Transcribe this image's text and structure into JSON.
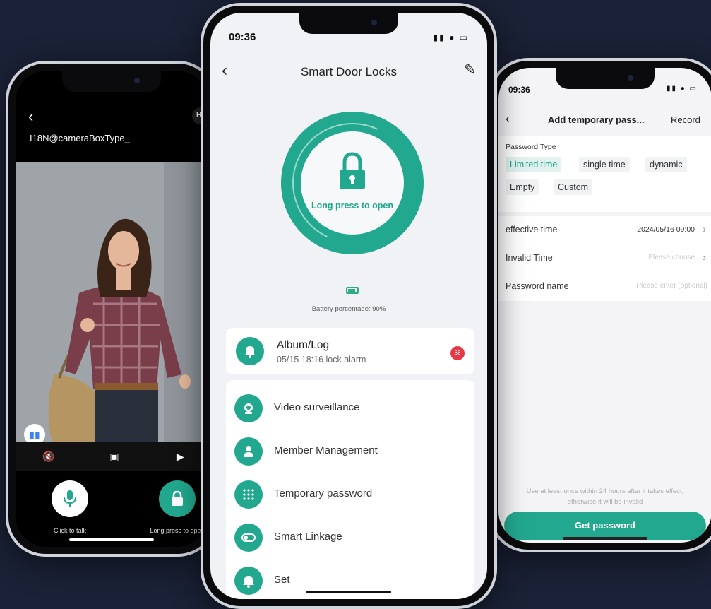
{
  "left_phone": {
    "camera_title": "I18N@cameraBoxType_",
    "hd_badge": "H",
    "talk_caption": "Click to talk",
    "open_caption": "Long press to open"
  },
  "center_phone": {
    "time": "09:36",
    "header_title": "Smart Door Locks",
    "lock_text": "Long press to open",
    "battery_text": "Battery percentage: 90%",
    "album": {
      "title": "Album/Log",
      "subtitle": "05/15 18:16 lock alarm",
      "badge": "66"
    },
    "menu": [
      {
        "label": "Video surveillance",
        "icon": "camera-icon"
      },
      {
        "label": "Member Management",
        "icon": "person-icon"
      },
      {
        "label": "Temporary password",
        "icon": "keypad-icon"
      },
      {
        "label": "Smart Linkage",
        "icon": "toggle-icon"
      },
      {
        "label": "Set",
        "icon": "bell-icon"
      }
    ]
  },
  "right_phone": {
    "time": "09:36",
    "header_title": "Add temporary pass...",
    "record_label": "Record",
    "password_type_label": "Password Type",
    "types": [
      "Limited time",
      "single time",
      "dynamic",
      "Empty",
      "Custom"
    ],
    "selected_type": "Limited time",
    "effective_time_label": "effective time",
    "effective_time_value": "2024/05/16 09:00",
    "invalid_time_label": "Invalid Time",
    "invalid_time_placeholder": "Please choose",
    "password_name_label": "Password name",
    "password_name_placeholder": "Please enter (optional)",
    "note_line1": "Use at least once within 24 hours after it takes effect,",
    "note_line2": "otherwise it will be invalid",
    "get_password_label": "Get password"
  },
  "colors": {
    "background": "#1b2136",
    "accent": "#22a88f",
    "badge": "#e53945"
  }
}
